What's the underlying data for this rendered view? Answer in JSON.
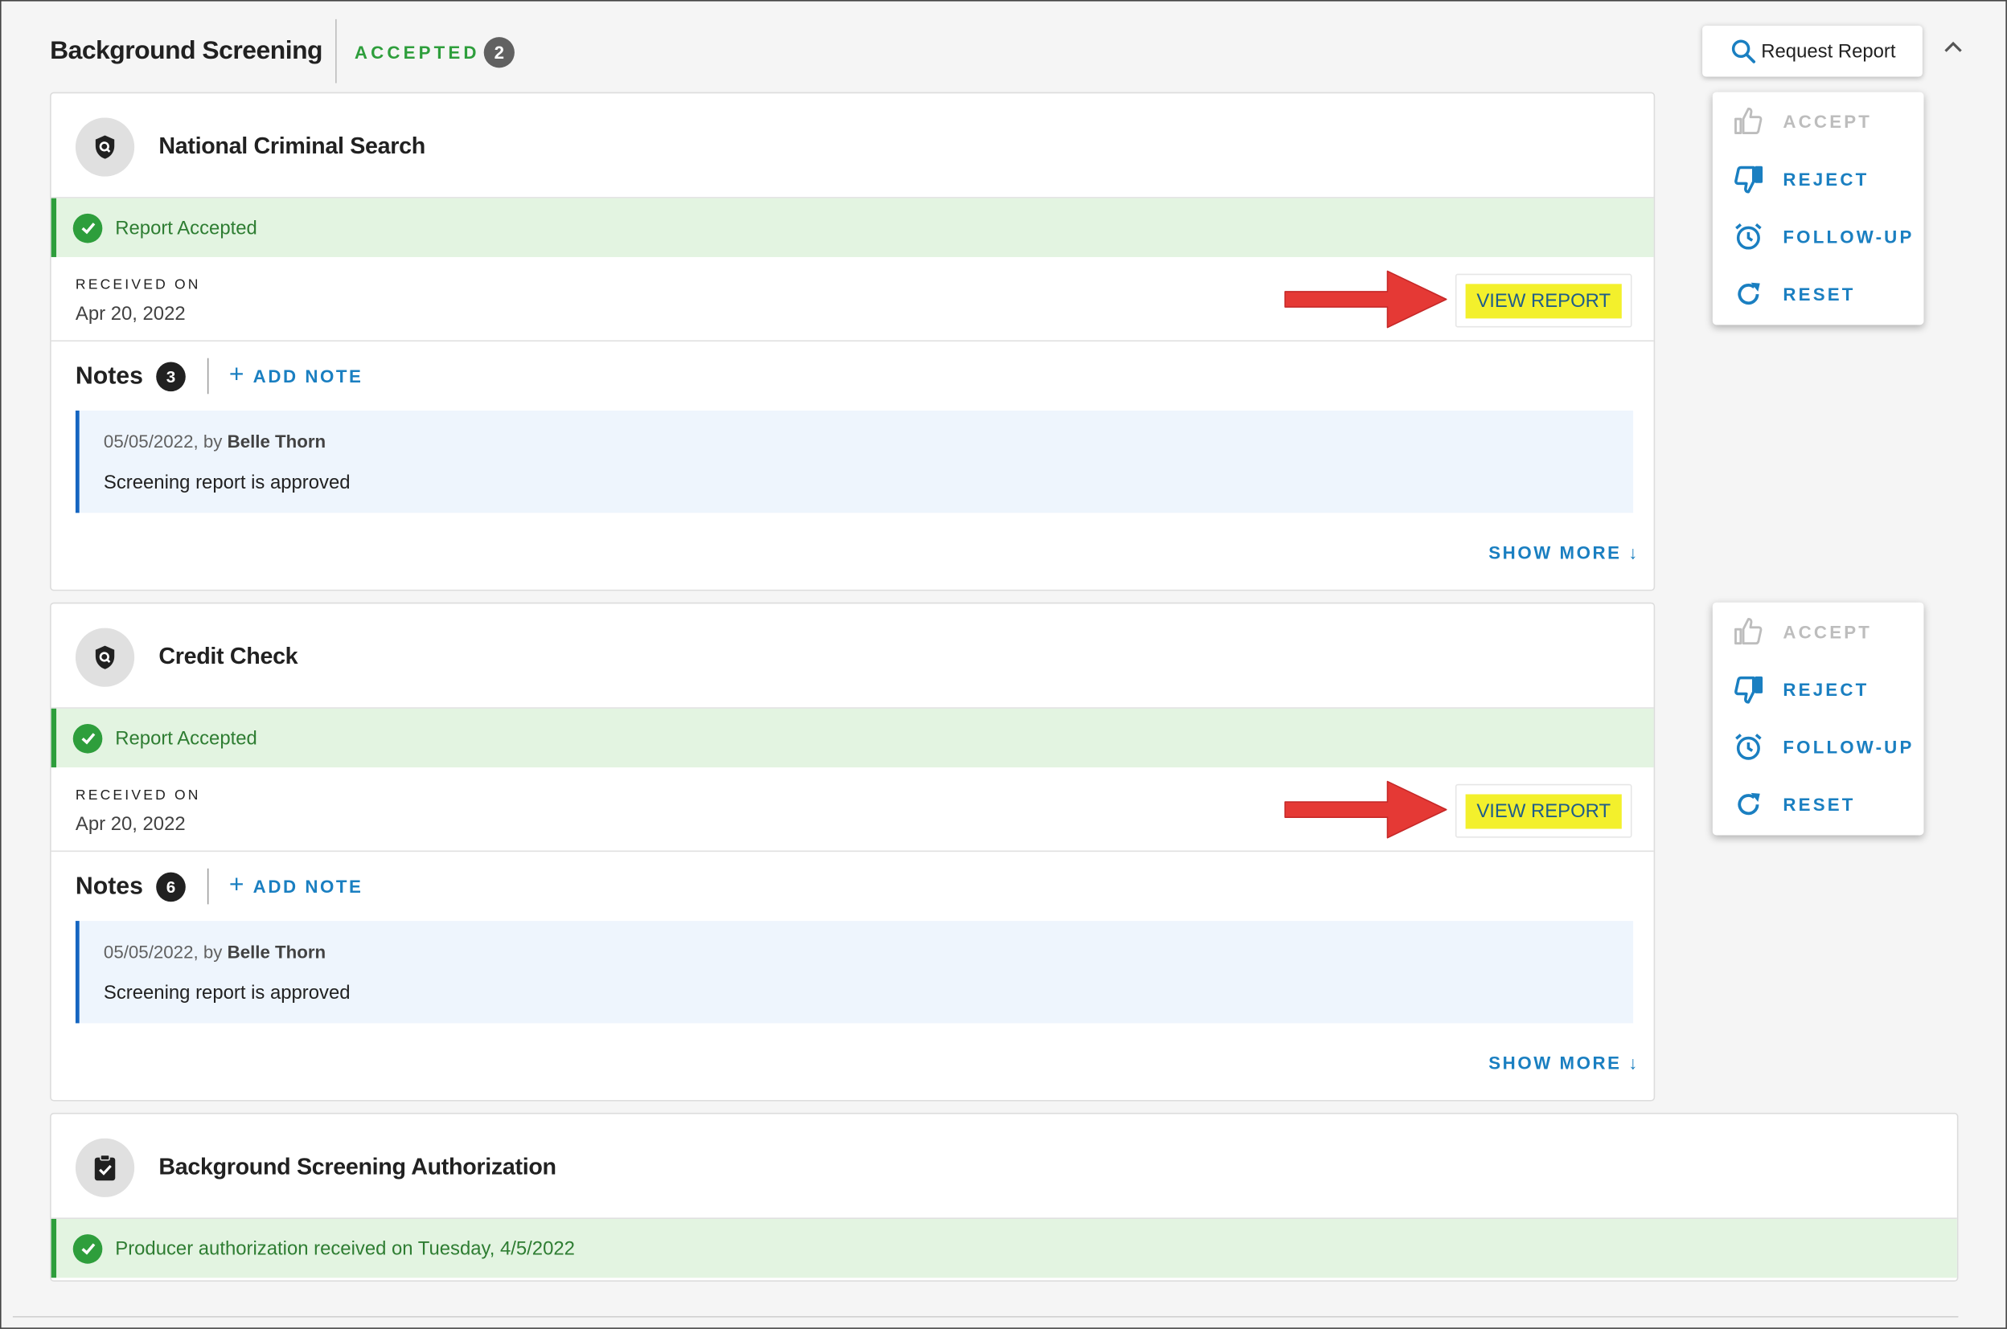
{
  "header": {
    "title": "Background Screening",
    "status_label": "ACCEPTED",
    "status_count": "2",
    "request_button": "Request Report"
  },
  "cards": [
    {
      "title": "National Criminal Search",
      "status": "Report Accepted",
      "received_label": "RECEIVED ON",
      "received_date": "Apr 20, 2022",
      "view_report": "VIEW REPORT",
      "notes_label": "Notes",
      "notes_count": "3",
      "add_note": "ADD NOTE",
      "note": {
        "date": "05/05/2022, by",
        "author": "Belle Thorn",
        "text": "Screening report is approved"
      },
      "show_more": "SHOW MORE ↓",
      "actions": {
        "accept": "ACCEPT",
        "reject": "REJECT",
        "followup": "FOLLOW-UP",
        "reset": "RESET"
      }
    },
    {
      "title": "Credit Check",
      "status": "Report Accepted",
      "received_label": "RECEIVED ON",
      "received_date": "Apr 20, 2022",
      "view_report": "VIEW REPORT",
      "notes_label": "Notes",
      "notes_count": "6",
      "add_note": "ADD NOTE",
      "note": {
        "date": "05/05/2022, by",
        "author": "Belle Thorn",
        "text": "Screening report is approved"
      },
      "show_more": "SHOW MORE ↓",
      "actions": {
        "accept": "ACCEPT",
        "reject": "REJECT",
        "followup": "FOLLOW-UP",
        "reset": "RESET"
      }
    },
    {
      "title": "Background Screening Authorization",
      "status": "Producer authorization received on Tuesday, 4/5/2022"
    }
  ],
  "colors": {
    "accent_blue": "#1a7fc1",
    "success_green": "#2e9e3c",
    "success_bg": "#e3f4e1",
    "highlight_yellow": "#f3f02c",
    "annotation_arrow": "#e53935"
  },
  "icons": [
    "shield-search-icon",
    "clipboard-check-icon",
    "check-circle-icon",
    "search-icon",
    "chevron-up-icon",
    "plus-icon",
    "thumbs-up-icon",
    "thumbs-down-icon",
    "alarm-clock-icon",
    "refresh-icon",
    "red-arrow-annotation"
  ]
}
